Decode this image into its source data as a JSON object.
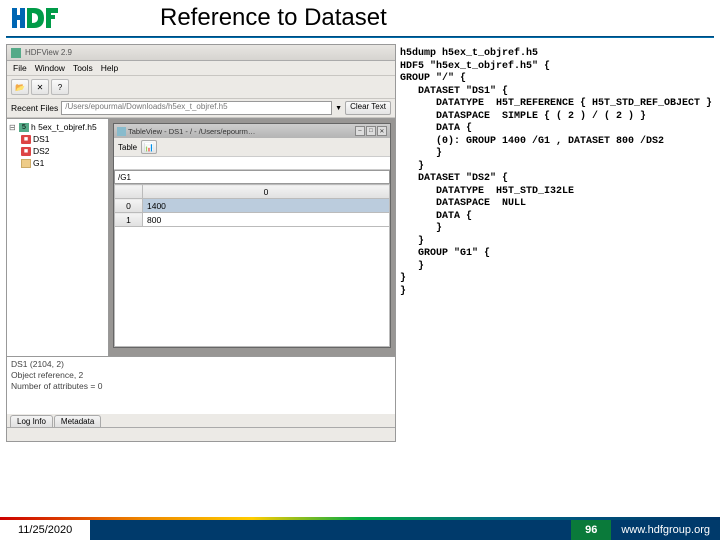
{
  "logo": {
    "text": "HDF"
  },
  "slide_title": "Reference to Dataset",
  "hdfview": {
    "window_title": "HDFView 2.9",
    "menu": {
      "file": "File",
      "window": "Window",
      "tools": "Tools",
      "help": "Help"
    },
    "recent_label": "Recent Files",
    "recent_path": "/Users/epourmal/Downloads/h5ex_t_objref.h5",
    "clear_text": "Clear Text",
    "tree": {
      "root": "h 5ex_t_objref.h5",
      "items": [
        "DS1",
        "DS2",
        "G1"
      ]
    },
    "tableview": {
      "title": "TableView - DS1 - / - /Users/epourm…",
      "menubar_label": "Table",
      "cell_display": "/G1",
      "headers": [
        "",
        "0"
      ],
      "rows": [
        [
          "0",
          "1400"
        ],
        [
          "1",
          "800"
        ]
      ]
    },
    "info": {
      "line1": "DS1 (2104, 2)",
      "line2": "Object reference,   2",
      "line3": "Number of attributes = 0"
    },
    "tabs": {
      "log_info": "Log Info",
      "metadata": "Metadata"
    }
  },
  "dump": "h5dump h5ex_t_objref.h5\nHDF5 \"h5ex_t_objref.h5\" {\nGROUP \"/\" {\n   DATASET \"DS1\" {\n      DATATYPE  H5T_REFERENCE { H5T_STD_REF_OBJECT }\n      DATASPACE  SIMPLE { ( 2 ) / ( 2 ) }\n      DATA {\n      (0): GROUP 1400 /G1 , DATASET 800 /DS2\n      }\n   }\n   DATASET \"DS2\" {\n      DATATYPE  H5T_STD_I32LE\n      DATASPACE  NULL\n      DATA {\n      }\n   }\n   GROUP \"G1\" {\n   }\n}\n}",
  "footer": {
    "date": "11/25/2020",
    "page": "96",
    "url": "www.hdfgroup.org"
  }
}
